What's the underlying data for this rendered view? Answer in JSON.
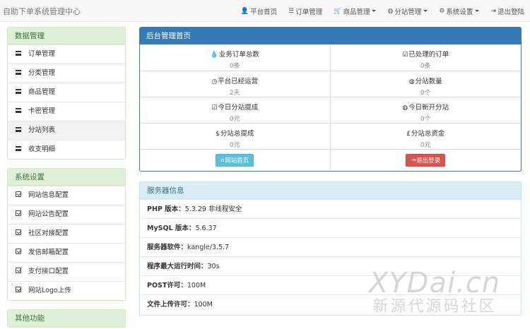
{
  "brand": "自助下单系统管理中心",
  "nav": [
    {
      "icon": "user-icon",
      "glyph": "👤",
      "label": "平台首页",
      "caret": false
    },
    {
      "icon": "list-icon",
      "glyph": "☰",
      "label": "订单管理",
      "caret": false
    },
    {
      "icon": "cart-icon",
      "glyph": "🛒",
      "label": "商品管理",
      "caret": true
    },
    {
      "icon": "globe-icon",
      "glyph": "◍",
      "label": "分站管理",
      "caret": true
    },
    {
      "icon": "cog-icon",
      "glyph": "⚙",
      "label": "系统设置",
      "caret": true
    },
    {
      "icon": "logout-icon",
      "glyph": "⇥",
      "label": "退出登陆",
      "caret": false
    }
  ],
  "sidebar": {
    "data_title": "数据管理",
    "data_items": [
      "订单管理",
      "分类管理",
      "商品管理",
      "卡密管理",
      "分站列表",
      "收支明细"
    ],
    "system_title": "系统设置",
    "system_items": [
      "网站信息配置",
      "网站公告配置",
      "社区对接配置",
      "发信邮箱配置",
      "支付接口配置",
      "网站Logo上传"
    ],
    "other_title": "其他功能"
  },
  "main": {
    "title": "后台管理首页",
    "stats": [
      {
        "icon": "tint-icon",
        "glyph": "💧",
        "label": "业务订单总数",
        "value": "0条"
      },
      {
        "icon": "check-icon",
        "glyph": "☑",
        "label": "已处理的订单",
        "value": "0条"
      },
      {
        "icon": "clock-icon",
        "glyph": "◷",
        "label": "平台已经运营",
        "value": "2天"
      },
      {
        "icon": "globe-icon",
        "glyph": "◍",
        "label": "分站数量",
        "value": "0个"
      },
      {
        "icon": "check-icon",
        "glyph": "☑",
        "label": "今日分站提成",
        "value": "0元"
      },
      {
        "icon": "globe-icon",
        "glyph": "◍",
        "label": "今日新开分站",
        "value": "0个"
      },
      {
        "icon": "usd-icon",
        "glyph": "$",
        "label": "分站总提成",
        "value": "0元"
      },
      {
        "icon": "gbp-icon",
        "glyph": "£",
        "label": "分站总资金",
        "value": "0元"
      }
    ],
    "home_button": "网站首页",
    "logout_button": "退出登录"
  },
  "server": {
    "title": "服务器信息",
    "rows": [
      {
        "label": "PHP 版本：",
        "value": "5.3.29 非线程安全"
      },
      {
        "label": "MySQL 版本：",
        "value": "5.6.37"
      },
      {
        "label": "服务器软件：",
        "value": "kangle/3.5.7"
      },
      {
        "label": "程序最大运行时间：",
        "value": "30s"
      },
      {
        "label": "POST许可：",
        "value": "100M"
      },
      {
        "label": "文件上传许可：",
        "value": "100M"
      }
    ]
  },
  "watermark": {
    "en": "XYDai.cn",
    "zh": "新源代源码社区"
  }
}
